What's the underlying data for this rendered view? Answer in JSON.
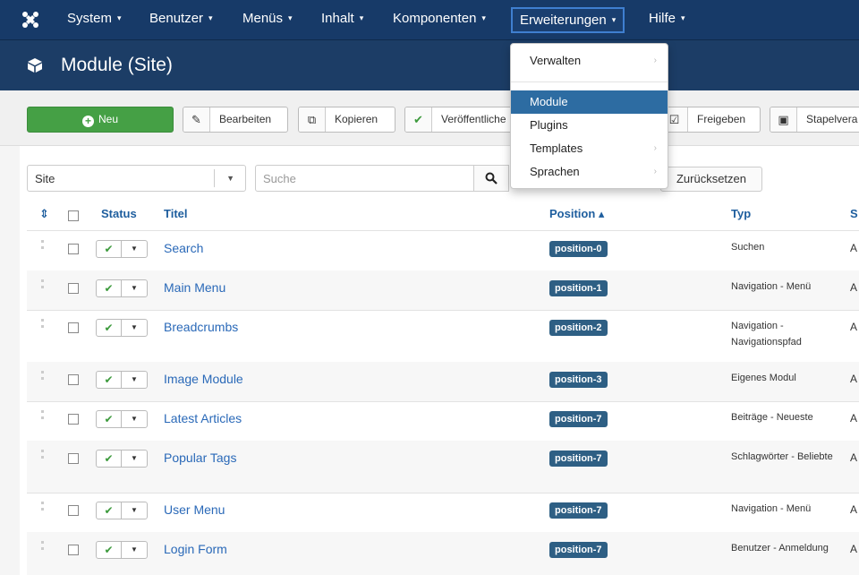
{
  "nav": {
    "items": [
      {
        "label": "System",
        "caret": "▾"
      },
      {
        "label": "Benutzer",
        "caret": "▾"
      },
      {
        "label": "Menüs",
        "caret": "▾"
      },
      {
        "label": "Inhalt",
        "caret": "▾"
      },
      {
        "label": "Komponenten",
        "caret": "▾"
      },
      {
        "label": "Erweiterungen",
        "caret": "▾"
      },
      {
        "label": "Hilfe",
        "caret": "▾"
      }
    ]
  },
  "page": {
    "title": "Module (Site)"
  },
  "toolbar": {
    "new": "Neu",
    "edit": "Bearbeiten",
    "copy": "Kopieren",
    "publish": "Veröffentliche",
    "checkin": "Freigeben",
    "batch": "Stapelvera"
  },
  "filters": {
    "client": "Site",
    "search_placeholder": "Suche",
    "reset": "Zurücksetzen"
  },
  "table": {
    "headers": {
      "status": "Status",
      "title": "Titel",
      "position": "Position ▴",
      "type": "Typ",
      "access": "S"
    },
    "rows": [
      {
        "title": "Search",
        "position": "position-0",
        "type": "Suchen",
        "access": "A"
      },
      {
        "title": "Main Menu",
        "position": "position-1",
        "type": "Navigation - Menü",
        "access": "A"
      },
      {
        "title": "Breadcrumbs",
        "position": "position-2",
        "type": "Navigation - Navigationspfad",
        "access": "A"
      },
      {
        "title": "Image Module",
        "position": "position-3",
        "type": "Eigenes Modul",
        "access": "A"
      },
      {
        "title": "Latest Articles",
        "position": "position-7",
        "type": "Beiträge - Neueste",
        "access": "A"
      },
      {
        "title": "Popular Tags",
        "position": "position-7",
        "type": "Schlagwörter - Beliebte",
        "access": "A"
      },
      {
        "title": "User Menu",
        "position": "position-7",
        "type": "Navigation - Menü",
        "access": "A"
      },
      {
        "title": "Login Form",
        "position": "position-7",
        "type": "Benutzer - Anmeldung",
        "access": "A"
      }
    ]
  },
  "menu": {
    "items": [
      {
        "label": "Verwalten",
        "submenu": "›"
      },
      {
        "label": "Module",
        "submenu": ""
      },
      {
        "label": "Plugins",
        "submenu": ""
      },
      {
        "label": "Templates",
        "submenu": "›"
      },
      {
        "label": "Sprachen",
        "submenu": "›"
      }
    ]
  },
  "colors": {
    "nav_bg": "#173a68",
    "title_bg": "#1c3d66",
    "accent": "#2d6ca2",
    "new_button": "#45a045",
    "badge": "#2e5f84",
    "link": "#2a69b8"
  },
  "icons": {
    "logo": "joomla-logo-icon",
    "page": "cube-icon",
    "search": "search-icon"
  }
}
